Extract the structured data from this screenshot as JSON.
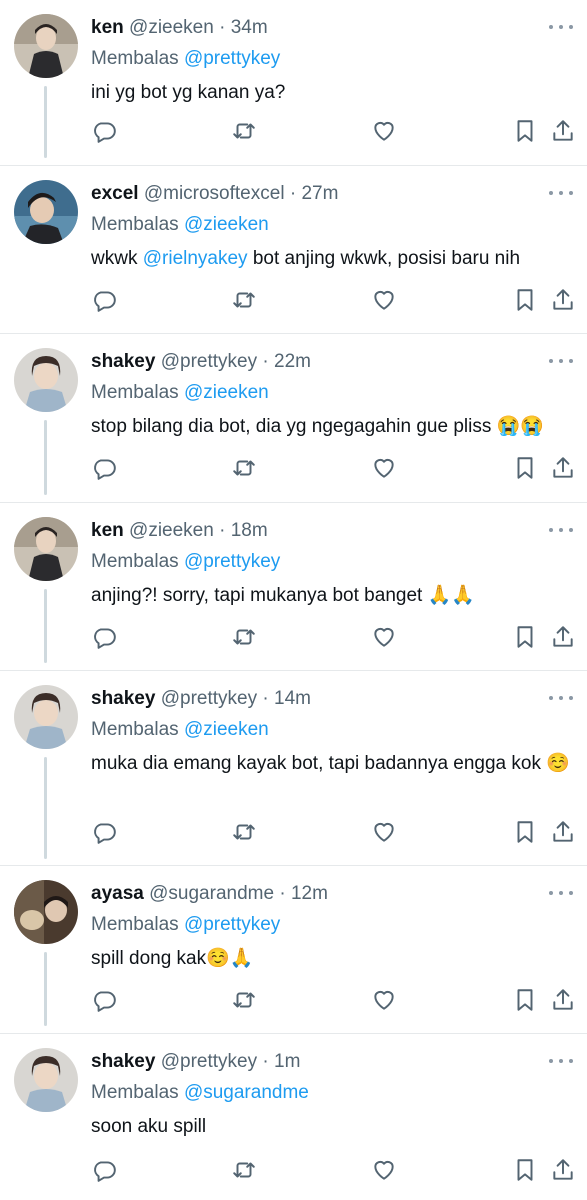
{
  "tweets": [
    {
      "name": "ken",
      "handle": "@zieeken",
      "time": "34m",
      "reply_label": "Membalas",
      "reply_to": "@prettykey",
      "text": "ini yg bot yg kanan ya?",
      "avatar": "avatar-ken"
    },
    {
      "name": "excel",
      "handle": "@microsoftexcel",
      "time": "27m",
      "reply_label": "Membalas",
      "reply_to": "@zieeken",
      "mention": "@rielnyakey",
      "text_before": "wkwk",
      "text_after": "bot anjing wkwk, posisi baru nih",
      "avatar": "avatar-excel"
    },
    {
      "name": "shakey",
      "handle": "@prettykey",
      "time": "22m",
      "reply_label": "Membalas",
      "reply_to": "@zieeken",
      "text": "stop bilang dia bot, dia yg ngegagahin gue pliss 😭😭",
      "avatar": "avatar-shakey"
    },
    {
      "name": "ken",
      "handle": "@zieeken",
      "time": "18m",
      "reply_label": "Membalas",
      "reply_to": "@prettykey",
      "text": "anjing?! sorry, tapi mukanya bot banget 🙏🙏",
      "avatar": "avatar-ken"
    },
    {
      "name": "shakey",
      "handle": "@prettykey",
      "time": "14m",
      "reply_label": "Membalas",
      "reply_to": "@zieeken",
      "text": "muka dia emang kayak bot, tapi badannya engga kok ☺️",
      "avatar": "avatar-shakey"
    },
    {
      "name": "ayasa",
      "handle": "@sugarandme",
      "time": "12m",
      "reply_label": "Membalas",
      "reply_to": "@prettykey",
      "text": "spill dong kak☺️🙏",
      "avatar": "avatar-ayasa"
    },
    {
      "name": "shakey",
      "handle": "@prettykey",
      "time": "1m",
      "reply_label": "Membalas",
      "reply_to": "@sugarandme",
      "text": "soon aku spill",
      "avatar": "avatar-shakey"
    }
  ],
  "separator": " · ",
  "colors": {
    "link": "#1d9bf0",
    "muted": "#536471",
    "text": "#0f1419",
    "thread_line": "#cfd9de",
    "divider": "#e6e9eb"
  }
}
